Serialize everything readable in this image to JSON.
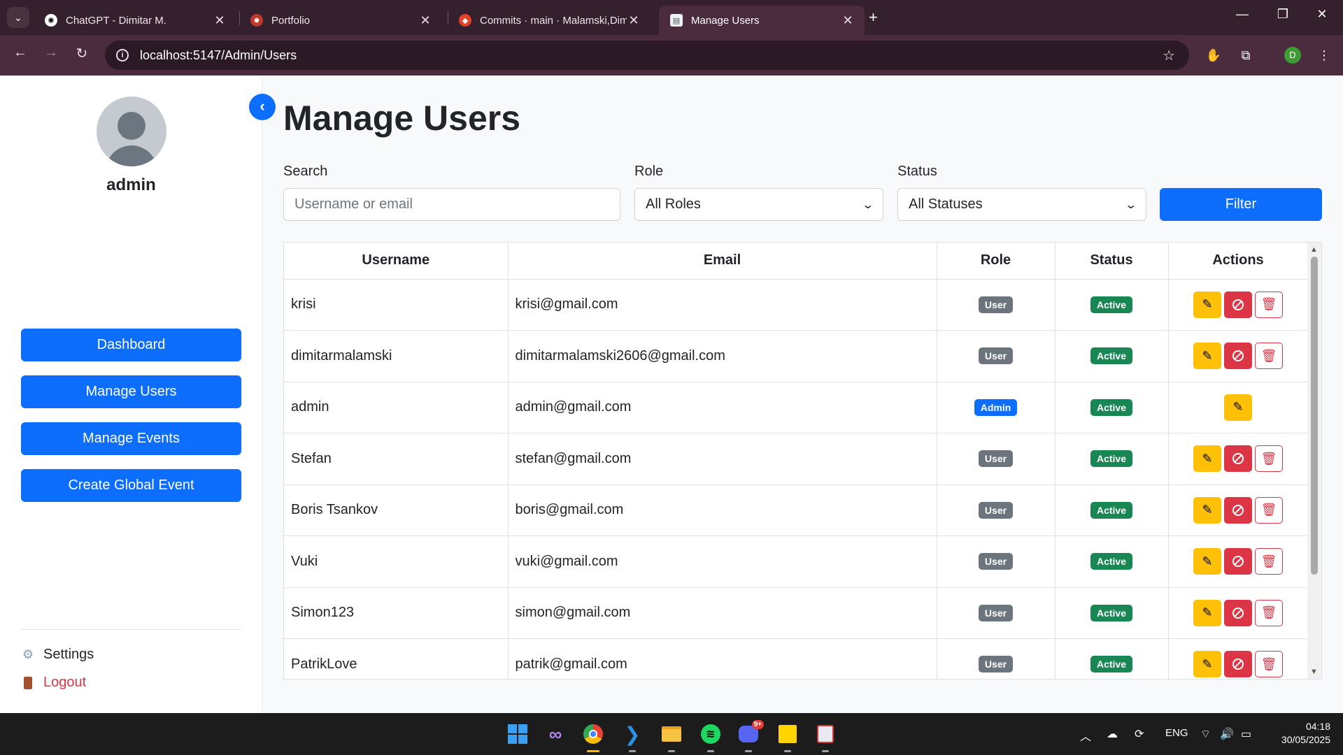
{
  "browser": {
    "tabs": [
      {
        "title": "ChatGPT - Dimitar M.",
        "active": false
      },
      {
        "title": "Portfolio",
        "active": false
      },
      {
        "title": "Commits · main · Malamski,Dim",
        "active": false
      },
      {
        "title": "Manage Users",
        "active": true
      }
    ],
    "url": "localhost:5147/Admin/Users",
    "profile_initial": "D"
  },
  "sidebar": {
    "username": "admin",
    "nav": [
      {
        "label": "Dashboard"
      },
      {
        "label": "Manage Users"
      },
      {
        "label": "Manage Events"
      },
      {
        "label": "Create Global Event"
      }
    ],
    "settings_label": "Settings",
    "logout_label": "Logout"
  },
  "page": {
    "title": "Manage Users",
    "filters": {
      "search_label": "Search",
      "search_placeholder": "Username or email",
      "role_label": "Role",
      "role_value": "All Roles",
      "status_label": "Status",
      "status_value": "All Statuses",
      "filter_button": "Filter"
    },
    "table": {
      "headers": [
        "Username",
        "Email",
        "Role",
        "Status",
        "Actions"
      ],
      "rows": [
        {
          "username": "krisi",
          "email": "krisi@gmail.com",
          "role": "User",
          "status": "Active"
        },
        {
          "username": "dimitarmalamski",
          "email": "dimitarmalamski2606@gmail.com",
          "role": "User",
          "status": "Active"
        },
        {
          "username": "admin",
          "email": "admin@gmail.com",
          "role": "Admin",
          "status": "Active"
        },
        {
          "username": "Stefan",
          "email": "stefan@gmail.com",
          "role": "User",
          "status": "Active"
        },
        {
          "username": "Boris Tsankov",
          "email": "boris@gmail.com",
          "role": "User",
          "status": "Active"
        },
        {
          "username": "Vuki",
          "email": "vuki@gmail.com",
          "role": "User",
          "status": "Active"
        },
        {
          "username": "Simon123",
          "email": "simon@gmail.com",
          "role": "User",
          "status": "Active"
        },
        {
          "username": "PatrikLove",
          "email": "patrik@gmail.com",
          "role": "User",
          "status": "Active"
        }
      ]
    }
  },
  "taskbar": {
    "language": "ENG",
    "time": "04:18",
    "date": "30/05/2025",
    "discord_badge": "9+"
  },
  "colors": {
    "primary": "#0d6efd",
    "success": "#198754",
    "secondary": "#6c757d",
    "warning": "#ffc107",
    "danger": "#dc3545"
  }
}
